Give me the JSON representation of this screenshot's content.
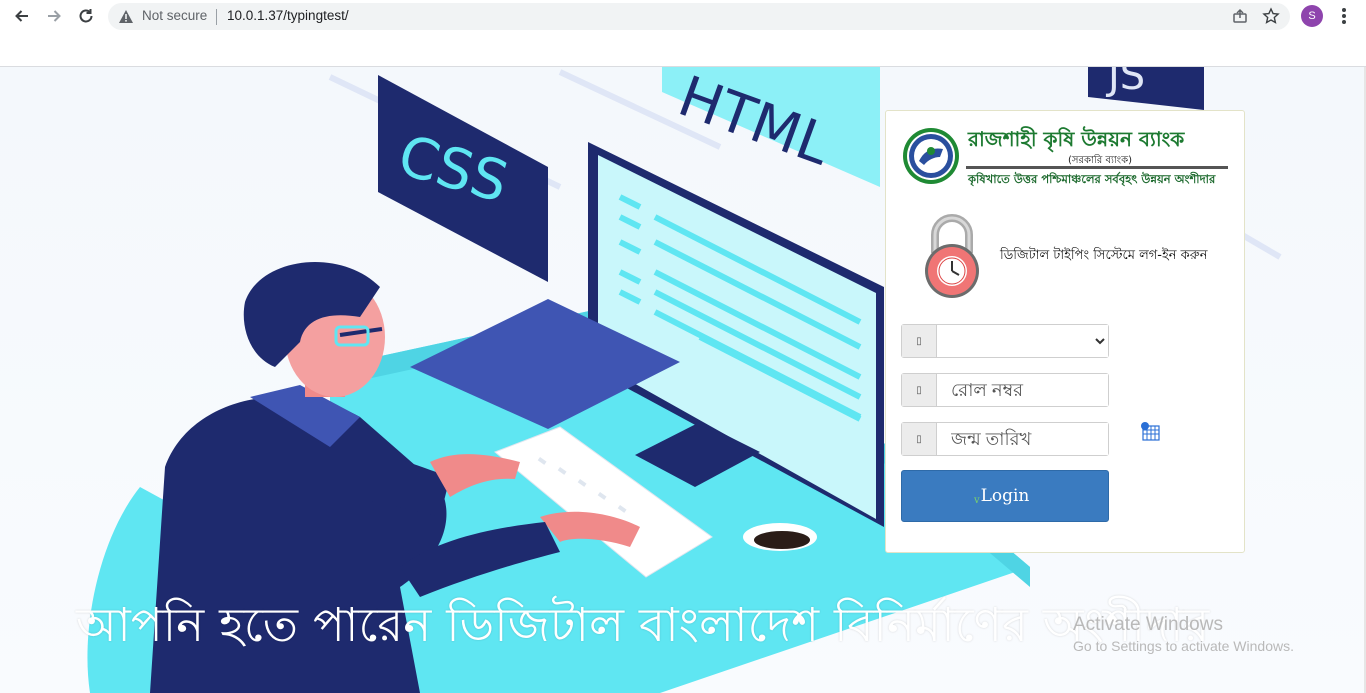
{
  "browser": {
    "security_label": "Not secure",
    "url": "10.0.1.37/typingtest/",
    "profile_initial": "S"
  },
  "bank": {
    "name": "রাজশাহী কৃষি উন্নয়ন ব্যাংক",
    "type": "(সরকারি ব্যাংক)",
    "tagline": "কৃষিখাতে উত্তর পশ্চিমাঞ্চলের সর্ববৃহৎ উন্নয়ন অংশীদার"
  },
  "login": {
    "message": "ডিজিটাল টাইপিং সিস্টেমে লগ-ইন করুন",
    "select_value": "",
    "roll_placeholder": "রোল নম্বর",
    "dob_placeholder": "জন্ম তারিখ",
    "button_label": "Login",
    "addon_glyph": "▯"
  },
  "illustration": {
    "css_label": "CSS",
    "html_label": "HTML",
    "js_label": "JS"
  },
  "headline": "আপনি হতে পারেন ডিজিটাল বাংলাদেশ বিনির্মাণের অংশীদার",
  "watermark": {
    "title": "Activate Windows",
    "subtitle": "Go to Settings to activate Windows."
  },
  "colors": {
    "accent": "#3a7bc0",
    "bank_green": "#1d7a31",
    "navy": "#1e2a6e",
    "cyan": "#5fe6f2"
  }
}
